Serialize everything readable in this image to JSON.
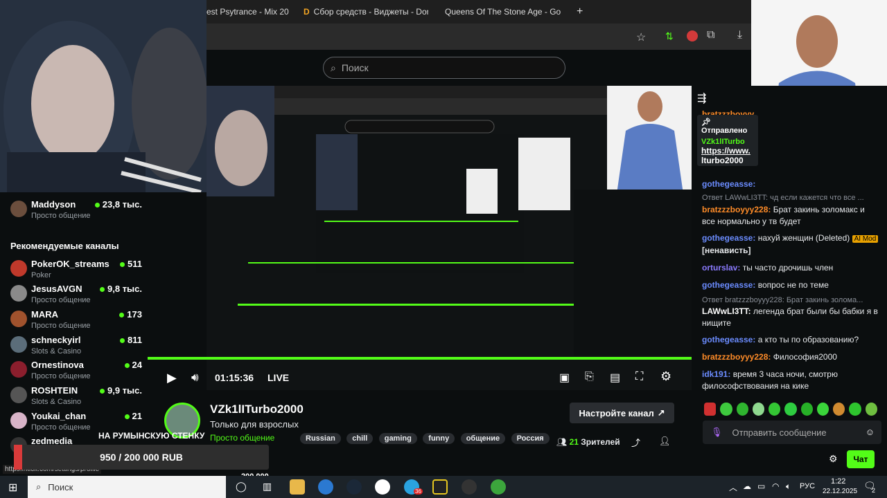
{
  "browser": {
    "tabs": [
      {
        "title": "est Psytrance - Mix 20"
      },
      {
        "title": "Сбор средств - Виджеты - Don"
      },
      {
        "title": "Queens Of The Stone Age - Go"
      }
    ],
    "new_tab": "+"
  },
  "page": {
    "search_placeholder": "Поиск"
  },
  "sidebar": {
    "current_channel": {
      "name": "Maddyson",
      "viewers": "23,8 тыс.",
      "category": "Просто общение"
    },
    "recommended_title": "Рекомендуемые каналы",
    "channels": [
      {
        "name": "PokerOK_streams",
        "viewers": "511",
        "category": "Poker"
      },
      {
        "name": "JesusAVGN",
        "viewers": "9,8 тыс.",
        "category": "Просто общение"
      },
      {
        "name": "MARA",
        "viewers": "173",
        "category": "Просто общение"
      },
      {
        "name": "schneckyirl",
        "viewers": "811",
        "category": "Slots & Casino"
      },
      {
        "name": "Ornestinova",
        "viewers": "24",
        "category": "Просто общение"
      },
      {
        "name": "ROSHTEIN",
        "viewers": "9,9 тыс.",
        "category": "Slots & Casino"
      },
      {
        "name": "Youkai_chan",
        "viewers": "21",
        "category": "Просто общение"
      },
      {
        "name": "zedmedia",
        "viewers": "",
        "category": ""
      }
    ],
    "status_url": "https://kick.com/settings/profile"
  },
  "player": {
    "time": "01:15:36",
    "live": "LIVE"
  },
  "stream": {
    "channel": "VZk1lITurbo2000",
    "title": "Только для взрослых",
    "category": "Просто общение",
    "tags": [
      "Russian",
      "chill",
      "gaming",
      "funny",
      "общение",
      "Россия"
    ],
    "setup_button": "Настройте канал",
    "viewers": "21",
    "viewers_label": "Зрителей"
  },
  "donation": {
    "message": "НА РУМЫНСКУЮ СТЕНКУ",
    "amount": "950 / 200 000 RUB",
    "goal": "200 000"
  },
  "chat": {
    "pinned_label": "Отправлено",
    "pinned_user": "VZk1lITurbo",
    "pinned_link": "https://www.",
    "pinned_link2": "lturbo2000",
    "partial_user": "bratzzzboyyy",
    "messages": [
      {
        "reply": "",
        "user": "gothegeasse:",
        "user_color": "#6b8cff",
        "text": ""
      },
      {
        "reply": "Ответ LAWwLI3TT: чд если кажется что все ...",
        "user": "bratzzzboyyy228:",
        "user_color": "#ff8c28",
        "text": "Брат закинь золомакс и все нормально у тв будет"
      },
      {
        "reply": "",
        "user": "gothegeasse:",
        "user_color": "#6b8cff",
        "text": "нахуй женщин (Deleted)",
        "badge": "AI Mod",
        "text2": "[ненависть]"
      },
      {
        "reply": "",
        "user": "orturslav:",
        "user_color": "#8b7bff",
        "text": "ты часто дрочишь член"
      },
      {
        "reply": "",
        "user": "gothegeasse:",
        "user_color": "#6b8cff",
        "text": "вопрос не по теме"
      },
      {
        "reply": "Ответ bratzzzboyyy228: Брат закинь золома...",
        "user": "LAWwLI3TT:",
        "user_color": "#ffffff",
        "text": "легенда брат были бы бабки я в нищите"
      },
      {
        "reply": "",
        "user": "gothegeasse:",
        "user_color": "#6b8cff",
        "text": "а кто ты по образованию?"
      },
      {
        "reply": "",
        "user": "bratzzzboyyy228:",
        "user_color": "#ff8c28",
        "text": "Философия2000"
      },
      {
        "reply": "",
        "user": "idk191:",
        "user_color": "#6b8cff",
        "text": "время 3 часа ночи, смотрю философствования на кике"
      }
    ],
    "input_placeholder": "Отправить сообщение",
    "send_button": "Чат"
  },
  "taskbar": {
    "search_placeholder": "Поиск",
    "language": "РУС",
    "time": "1:22",
    "date": "22.12.2025",
    "notification_count": "2",
    "telegram_badge": "36"
  },
  "colors": {
    "accent": "#53fc18",
    "background": "#0b0e0f",
    "taskbar": "#1c2329"
  }
}
